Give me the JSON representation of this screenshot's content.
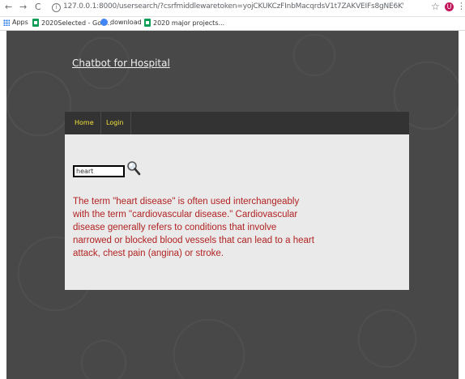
{
  "browser": {
    "url": "127.0.0.1:8000/usersearch/?csrfmiddlewaretoken=yojCKUKCzFInbMacqrdsV1t7ZAKVEIFs8gNE6KVNRy5V1WFD4nGAEZxSfCh5&query=heart&search.x=78&search...",
    "nav_back": "←",
    "nav_forward": "→",
    "nav_reload": "C",
    "info_glyph": "i",
    "star_glyph": "☆",
    "profile_letter": "U",
    "menu_glyph": "⋮"
  },
  "bookmarks": [
    {
      "label": "Apps",
      "icon": "apps-grid-icon"
    },
    {
      "label": "2020Selected - Goo...",
      "icon": "sheets-icon"
    },
    {
      "label": "download",
      "icon": "download-icon"
    },
    {
      "label": "2020 major projects...",
      "icon": "sheets-icon"
    }
  ],
  "site": {
    "title": "Chatbot for Hospital"
  },
  "nav": {
    "home": "Home",
    "login": "Login"
  },
  "search": {
    "query": "heart"
  },
  "answer": {
    "text": "The term \"heart disease\" is often used interchangeably with the term \"cardiovascular disease.\" Cardiovascular disease generally refers to conditions that involve narrowed or blocked blood vessels that can lead to a heart attack, chest pain (angina) or stroke."
  },
  "colors": {
    "page_bg": "#484848",
    "nav_bg": "#333333",
    "nav_text": "#f2e23a",
    "content_bg": "#eaeaea",
    "answer_text": "#b22222"
  }
}
